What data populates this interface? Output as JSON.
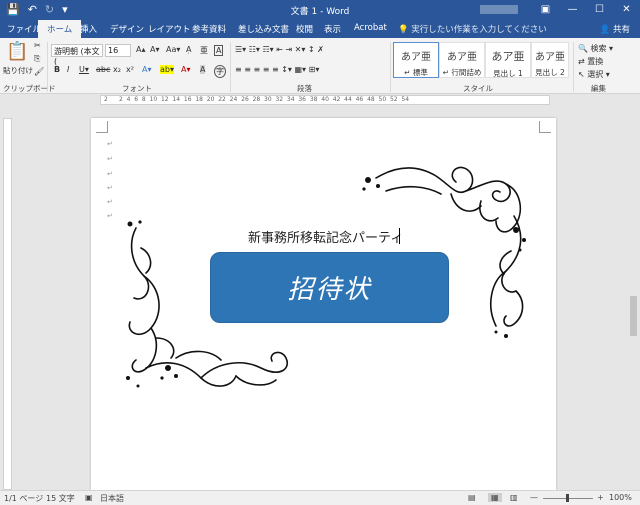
{
  "titlebar": {
    "title": "文書 1 - Word",
    "window_controls": {
      "ribbon_options": "▣",
      "minimize": "—",
      "maximize": "☐",
      "close": "✕"
    }
  },
  "quick_access": {
    "save": "💾",
    "undo": "↶",
    "redo": "↻",
    "customize": "▾"
  },
  "tabs": {
    "file": "ファイル",
    "home": "ホーム",
    "insert": "挿入",
    "design": "デザイン",
    "layout": "レイアウト",
    "references": "参考資料",
    "mailings": "差し込み文書",
    "review": "校閲",
    "view": "表示",
    "acrobat": "Acrobat"
  },
  "tellme": {
    "text": "実行したい作業を入力してください"
  },
  "share": {
    "label": "共有"
  },
  "clipboard": {
    "paste": "貼り付け",
    "label": "クリップボード",
    "cut": "✂",
    "copy": "⎘",
    "format_painter": "🖌"
  },
  "font": {
    "label": "フォント",
    "name": "游明朝 (本文(",
    "size": "16",
    "grow": "A▴",
    "shrink": "A▾",
    "change_case": "Aa▾",
    "clear": "Ạ",
    "phonetic": "亜",
    "enclose": "A",
    "bold": "B",
    "italic": "I",
    "underline": "U▾",
    "strike": "abc",
    "subscript": "x₂",
    "superscript": "x²",
    "text_effects": "A▾",
    "highlight": "ab▾",
    "font_color": "A▾",
    "shading": "A",
    "enclose_char": "字"
  },
  "paragraph": {
    "label": "段落",
    "row1": "☰▾ ☷▾ ☶▾ ⇤ ⇥ ✕▾ ↕ ✗",
    "row2": "≡ ≡ ≡ ≡ ≡ ↕▾ ▦▾ ⊞▾"
  },
  "styles": {
    "label": "スタイル",
    "items": [
      {
        "preview": "あア亜",
        "name": "↵ 標準"
      },
      {
        "preview": "あア亜",
        "name": "↵ 行間詰め"
      },
      {
        "preview": "あア亜",
        "name": "見出し 1"
      },
      {
        "preview": "あア亜",
        "name": "見出し 2"
      }
    ]
  },
  "editing": {
    "label": "編集",
    "find": "検索 ▾",
    "replace": "置換",
    "select": "選択 ▾"
  },
  "ruler": {
    "left_num": "2",
    "right_num": "54",
    "marks": "2  4  6  8  10  12  14  16  18  20  22  24  26  28  30  32  34  36  38  40  42  44  46  48  50  52  54"
  },
  "document": {
    "paragraph_mark": "↵",
    "headline": "新事務所移転記念パーティ",
    "banner_text": "招待状"
  },
  "statusbar": {
    "page": "1/1 ページ",
    "words": "15 文字",
    "language": "日本語",
    "zoom": "100%",
    "zoom_out": "—",
    "zoom_in": "+"
  }
}
